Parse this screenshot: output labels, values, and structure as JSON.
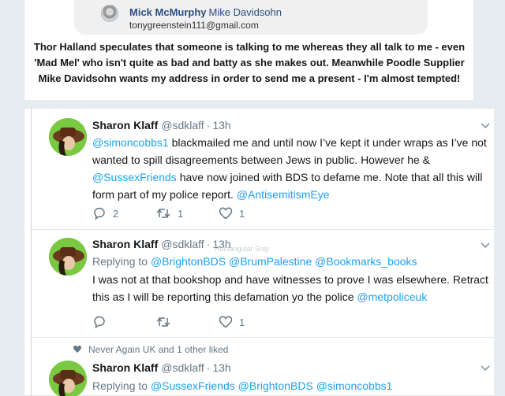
{
  "quoted_email": {
    "sender_name": "Mick McMurphy",
    "recipient_name": "Mike Davidsohn",
    "sender_email": "tonygreenstein111@gmail.com",
    "body": "Thor Halland speculates that someone is talking to me whereas they all talk to me - even 'Mad Mel' who isn't quite as bad and batty as she makes out. Meanwhile Poodle Supplier Mike Davidsohn wants my address in order to send me a present - I'm almost tempted!"
  },
  "tweets": [
    {
      "name": "Sharon Klaff",
      "handle": "@sdklaff",
      "dot": "·",
      "time": "13h",
      "text_parts": [
        {
          "t": "@simoncobbs1",
          "link": true
        },
        {
          "t": "  blackmailed me and until now I’ve kept it under wraps as I’ve not wanted to spill disagreements between Jews in public. However he & ",
          "link": false
        },
        {
          "t": "@SussexFriends",
          "link": true
        },
        {
          "t": " have now joined with BDS to defame me. Note that all this will form part of my police report. ",
          "link": false
        },
        {
          "t": "@AntisemitismEye",
          "link": true
        }
      ],
      "replies": "2",
      "retweets": "1",
      "likes": "1"
    },
    {
      "name": "Sharon Klaff",
      "handle": "@sdklaff",
      "dot": "·",
      "time": "13h",
      "replying_label": "Replying to",
      "replying_to": [
        "@BrightonBDS",
        "@BrumPalestine",
        "@Bookmarks_books"
      ],
      "text_parts": [
        {
          "t": "I was not at that bookshop and have witnesses to prove I was elsewhere. Retract this as I will be reporting  this defamation yo the police ",
          "link": false
        },
        {
          "t": "@metpoliceuk",
          "link": true
        }
      ],
      "replies": "",
      "retweets": "",
      "likes": "1"
    },
    {
      "liked_by": "Never Again UK and 1 other liked",
      "name": "Sharon Klaff",
      "handle": "@sdklaff",
      "dot": "·",
      "time": "13h",
      "replying_label": "Replying to",
      "replying_to": [
        "@SussexFriends",
        "@BrightonBDS",
        "@simoncobbs1"
      ]
    }
  ],
  "overlay_ghost_text": "Rectangular Snip",
  "colors": {
    "link": "#1da1f2",
    "muted": "#657786",
    "text": "#14171a",
    "background": "#e6ecf0",
    "avatar_bg": "#7ac943"
  },
  "icons": [
    "reply-icon",
    "retweet-icon",
    "like-icon",
    "chevron-down-icon",
    "heart-icon"
  ]
}
